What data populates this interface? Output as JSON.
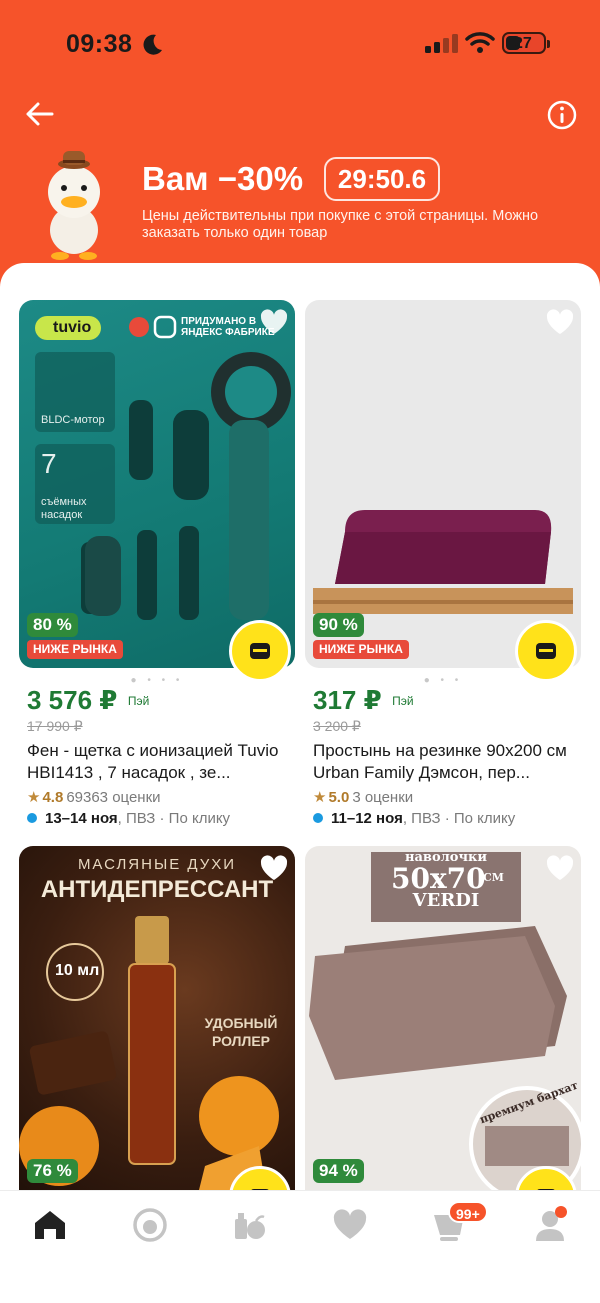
{
  "status_bar": {
    "time": "09:38",
    "battery": "27"
  },
  "header": {
    "promo_title": "Вам −30%",
    "timer": "29:50.6",
    "note": "Цены действительны при покупке с этой страницы. Можно заказать только один товар"
  },
  "products": [
    {
      "image_text": {
        "brand": "tuvio",
        "feature1": "BLDC-мотор",
        "count": "7",
        "count_label": "съёмных насадок",
        "factory": "ПРИДУМАНО В ЯНДЕКС ФАБРИКЕ"
      },
      "discount": "80 %",
      "below_market": "НИЖЕ РЫНКА",
      "price": "3 576 ₽",
      "pay": "Пэй",
      "old_price": "17 990 ₽",
      "title": "Фен - щетка с ионизацией Tuvio HBI1413 , 7 насадок , зе...",
      "rating": "4.8",
      "reviews": "69363 оценки",
      "delivery_date": "13–14 ноя",
      "delivery_rest": ", ПВЗ · По клику"
    },
    {
      "discount": "90 %",
      "below_market": "НИЖЕ РЫНКА",
      "price": "317 ₽",
      "pay": "Пэй",
      "old_price": "3 200 ₽",
      "title": "Простынь на резинке 90х200 см Urban Family Дэмсон, пер...",
      "rating": "5.0",
      "reviews": "3 оценки",
      "delivery_date": "11–12 ноя",
      "delivery_rest": ", ПВЗ · По клику"
    },
    {
      "image_text": {
        "line1": "МАСЛЯНЫЕ ДУХИ",
        "line2": "АНТИДЕПРЕССАНТ",
        "volume": "10 мл",
        "roller": "УДОБНЫЙ РОЛЛЕР"
      },
      "discount": "76 %"
    },
    {
      "image_text": {
        "label": "наволочки",
        "size": "50х70",
        "unit": "СМ",
        "brand": "VERDI",
        "premium": "премиум бархат"
      },
      "discount": "94 %"
    }
  ],
  "tabbar": {
    "cart_badge": "99+"
  }
}
